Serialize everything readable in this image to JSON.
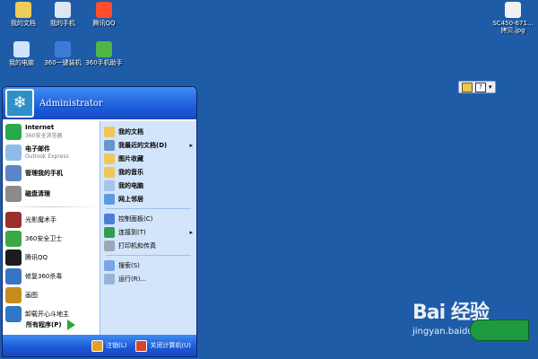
{
  "desktop": {
    "icons": [
      {
        "label": "我的文档",
        "color": "#f0cc58"
      },
      {
        "label": "我的手机",
        "color": "#dfe6ef"
      },
      {
        "label": "腾讯QQ",
        "color": "#ff4d2e"
      },
      {
        "label": "我的电脑",
        "color": "#cfe3ff"
      },
      {
        "label": "360一键装机",
        "color": "#3b7cd6"
      },
      {
        "label": "360手机助手",
        "color": "#50b447"
      },
      {
        "label": "SC450-671...\n拷贝.jpg",
        "color": "#f1f1f1"
      }
    ]
  },
  "start_menu": {
    "username": "Administrator",
    "pinned": [
      {
        "title": "Internet",
        "subtitle": "360安全浏览器",
        "icon": "browser-icon",
        "color": "#2aa94a"
      },
      {
        "title": "电子邮件",
        "subtitle": "Outlook Express",
        "icon": "email-icon",
        "color": "#8fbce8"
      },
      {
        "title": "管理我的手机",
        "subtitle": "",
        "icon": "phone-icon",
        "color": "#5d86c7"
      },
      {
        "title": "磁盘清理",
        "subtitle": "",
        "icon": "disk-cleanup-icon",
        "color": "#8b8b8b"
      }
    ],
    "mfu": [
      {
        "title": "光影魔术手",
        "icon": "photo-icon",
        "color": "#9a2f2f"
      },
      {
        "title": "360安全卫士",
        "icon": "shield-icon",
        "color": "#3ba844"
      },
      {
        "title": "腾讯QQ",
        "icon": "qq-icon",
        "color": "#1c1c1c"
      },
      {
        "title": "修复360杀毒",
        "icon": "repair-icon",
        "color": "#3874c6"
      },
      {
        "title": "画图",
        "icon": "paint-icon",
        "color": "#c78c1e"
      },
      {
        "title": "卸载开心斗地主",
        "icon": "uninstall-icon",
        "color": "#2f77c7"
      }
    ],
    "all_programs": "所有程序(P)",
    "right": [
      {
        "label": "我的文档",
        "icon": "folder-icon",
        "color": "#f1c75a",
        "strong": true
      },
      {
        "label": "我最近的文档(D)",
        "icon": "recent-docs-icon",
        "color": "#6994c9",
        "strong": true,
        "arrow": "▸"
      },
      {
        "label": "图片收藏",
        "icon": "pictures-icon",
        "color": "#f1c75a",
        "strong": true
      },
      {
        "label": "我的音乐",
        "icon": "music-icon",
        "color": "#f1c75a",
        "strong": true
      },
      {
        "label": "我的电脑",
        "icon": "computer-icon",
        "color": "#a6c3ec",
        "strong": true
      },
      {
        "label": "网上邻居",
        "icon": "network-icon",
        "color": "#5b9be2",
        "strong": true
      },
      {
        "sep": true
      },
      {
        "label": "控制面板(C)",
        "icon": "control-panel-icon",
        "color": "#4a7fd8",
        "strong": false
      },
      {
        "label": "连接到(T)",
        "icon": "connect-icon",
        "color": "#2f9f4d",
        "strong": false,
        "arrow": "▸"
      },
      {
        "label": "打印机和传真",
        "icon": "printer-icon",
        "color": "#9da7b5",
        "strong": false
      },
      {
        "sep": true
      },
      {
        "label": "搜索(S)",
        "icon": "search-icon",
        "color": "#7aa6e6",
        "strong": false
      },
      {
        "label": "运行(R)...",
        "icon": "run-icon",
        "color": "#9ab3d7",
        "strong": false
      }
    ],
    "footer": {
      "logoff": "注销(L)",
      "shutdown": "关闭计算机(U)"
    }
  },
  "watermark": {
    "logo": "Bai 经验",
    "url": "jingyan.baidu.com"
  }
}
